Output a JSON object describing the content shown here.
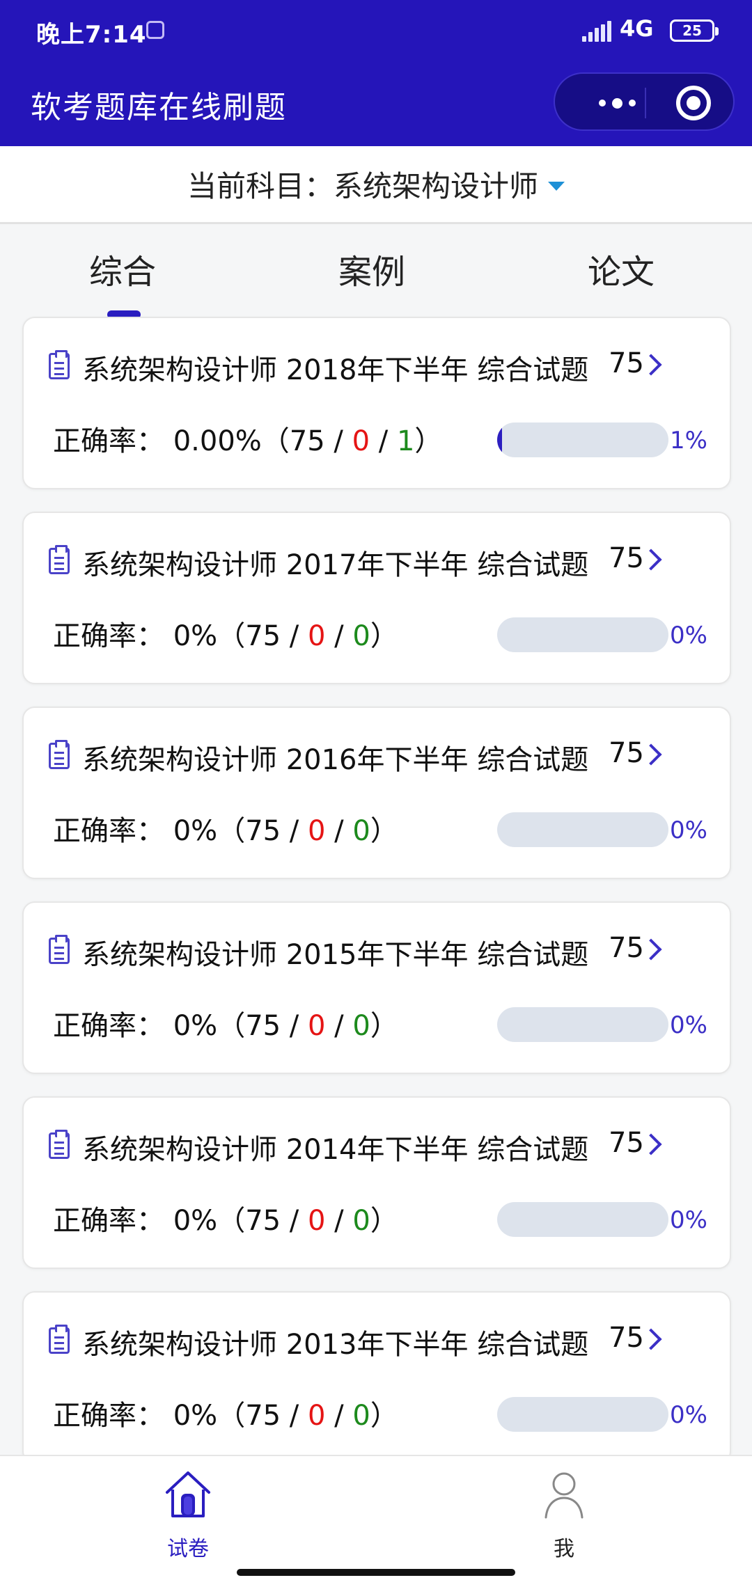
{
  "status_bar": {
    "time": "晚上7:14",
    "network": "4G",
    "battery": "25"
  },
  "nav": {
    "title": "软考题库在线刷题",
    "more_icon": "more-dots-icon",
    "close_icon": "target-icon"
  },
  "subject": {
    "prefix": "当前科目：",
    "value": "系统架构设计师"
  },
  "tabs": [
    {
      "label": "综合",
      "active": true
    },
    {
      "label": "案例",
      "active": false
    },
    {
      "label": "论文",
      "active": false
    }
  ],
  "rate_label": "正确率：",
  "papers": [
    {
      "title": "系统架构设计师 2018年下半年 综合试题",
      "count": "75",
      "rate": "0.00%",
      "total": "75",
      "wrong": "0",
      "done": "1",
      "progress": 1,
      "progress_label": "1%"
    },
    {
      "title": "系统架构设计师 2017年下半年 综合试题",
      "count": "75",
      "rate": "0%",
      "total": "75",
      "wrong": "0",
      "done": "0",
      "progress": 0,
      "progress_label": "0%"
    },
    {
      "title": "系统架构设计师 2016年下半年 综合试题",
      "count": "75",
      "rate": "0%",
      "total": "75",
      "wrong": "0",
      "done": "0",
      "progress": 0,
      "progress_label": "0%"
    },
    {
      "title": "系统架构设计师 2015年下半年 综合试题",
      "count": "75",
      "rate": "0%",
      "total": "75",
      "wrong": "0",
      "done": "0",
      "progress": 0,
      "progress_label": "0%"
    },
    {
      "title": "系统架构设计师 2014年下半年 综合试题",
      "count": "75",
      "rate": "0%",
      "total": "75",
      "wrong": "0",
      "done": "0",
      "progress": 0,
      "progress_label": "0%"
    },
    {
      "title": "系统架构设计师 2013年下半年 综合试题",
      "count": "75",
      "rate": "0%",
      "total": "75",
      "wrong": "0",
      "done": "0",
      "progress": 0,
      "progress_label": "0%"
    }
  ],
  "bottom_nav": [
    {
      "label": "试卷",
      "icon": "home-icon",
      "active": true
    },
    {
      "label": "我",
      "icon": "user-icon",
      "active": false
    }
  ],
  "colors": {
    "brand": "#2515b9",
    "accent": "#2a1ec0",
    "wrong": "#e51414",
    "correct": "#1d8a1d"
  }
}
